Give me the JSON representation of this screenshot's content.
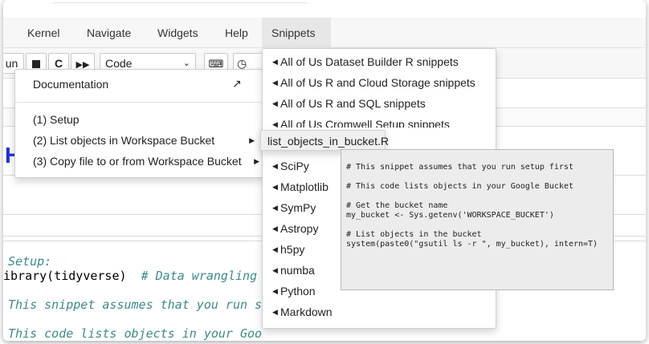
{
  "menubar": {
    "items": [
      "Kernel",
      "Navigate",
      "Widgets",
      "Help",
      "Snippets"
    ]
  },
  "toolbar": {
    "run_label": "un",
    "cell_type": "Code"
  },
  "left_menu": {
    "documentation": "Documentation",
    "items": [
      "(1) Setup",
      "(2) List objects in Workspace Bucket",
      "(3) Copy file to or from Workspace Bucket"
    ]
  },
  "snippets_menu": {
    "items": [
      "All of Us Dataset Builder R snippets",
      "All of Us R and Cloud Storage snippets",
      "All of Us R and SQL snippets",
      "All of Us Cromwell Setup snippets",
      "",
      "SciPy",
      "Matplotlib",
      "SymPy",
      "Astropy",
      "h5py",
      "numba",
      "Python",
      "Markdown"
    ]
  },
  "submenu_item": "list_objects_in_bucket.R",
  "tooltip_lines": [
    "# This snippet assumes that you run setup first",
    "",
    "# This code lists objects in your Google Bucket",
    "",
    "# Get the bucket name",
    "my_bucket <- Sys.getenv('WORKSPACE_BUCKET')",
    "",
    "# List objects in the bucket",
    "system(paste0(\"gsutil ls -r \", my_bucket), intern=T)"
  ],
  "notebook": {
    "heading_char": "H",
    "code_lines": [
      "Setup:",
      "ibrary(tidyverse)",
      "# Data wrangling",
      "This snippet assumes that you run s",
      "This code lists objects in your Goo"
    ]
  },
  "colors": {
    "heading": "#1d2fe0",
    "comment": "#3d8a8a"
  }
}
